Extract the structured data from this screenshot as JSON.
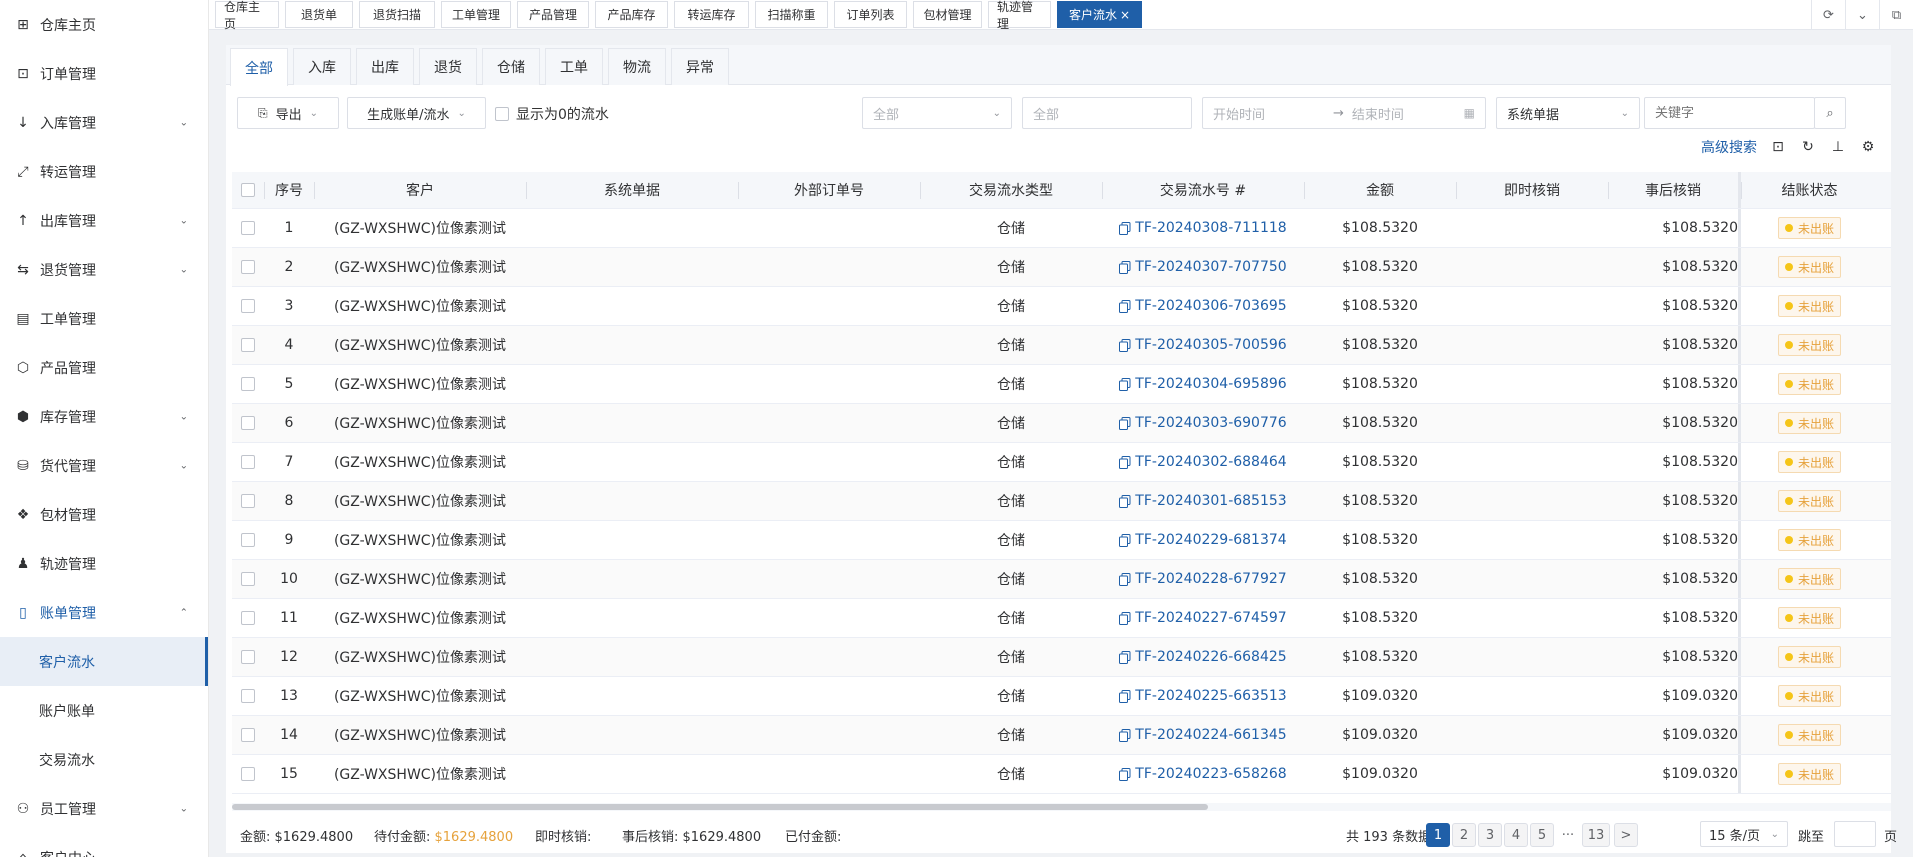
{
  "sidebar": {
    "items": [
      {
        "label": "仓库主页",
        "icon": "grid-icon",
        "chev": ""
      },
      {
        "label": "订单管理",
        "icon": "order-icon",
        "chev": ""
      },
      {
        "label": "入库管理",
        "icon": "arrow-down-icon",
        "chev": "⌄"
      },
      {
        "label": "转运管理",
        "icon": "transfer-icon",
        "chev": ""
      },
      {
        "label": "出库管理",
        "icon": "arrow-up-icon",
        "chev": "⌄"
      },
      {
        "label": "退货管理",
        "icon": "return-icon",
        "chev": "⌄"
      },
      {
        "label": "工单管理",
        "icon": "ticket-icon",
        "chev": ""
      },
      {
        "label": "产品管理",
        "icon": "product-icon",
        "chev": ""
      },
      {
        "label": "库存管理",
        "icon": "box-icon",
        "chev": "⌄"
      },
      {
        "label": "货代管理",
        "icon": "network-icon",
        "chev": "⌄"
      },
      {
        "label": "包材管理",
        "icon": "dropbox-icon",
        "chev": ""
      },
      {
        "label": "轨迹管理",
        "icon": "bell-icon",
        "chev": ""
      },
      {
        "label": "账单管理",
        "icon": "bill-icon",
        "chev": "⌃"
      }
    ],
    "sub_items": [
      "客户流水",
      "账户账单",
      "交易流水"
    ],
    "after_items": [
      {
        "label": "员工管理",
        "icon": "user-icon",
        "chev": "⌄"
      },
      {
        "label": "客户中心",
        "icon": "customer-icon",
        "chev": ""
      }
    ]
  },
  "top_tabs": [
    "仓库主页",
    "退货单",
    "退货扫描",
    "工单管理",
    "产品管理",
    "产品库存",
    "转运库存",
    "扫描称重",
    "订单列表",
    "包材管理",
    "轨迹管理",
    "客户流水"
  ],
  "top_tab_close": "×",
  "sub_tabs": [
    "全部",
    "入库",
    "出库",
    "退货",
    "仓储",
    "工单",
    "物流",
    "异常"
  ],
  "toolbar": {
    "export": "导出",
    "generate": "生成账单/流水",
    "show_zero": "显示为0的流水",
    "filter_all_select": "全部",
    "filter_all_input": "全部",
    "start_time": "开始时间",
    "arrow": "→",
    "end_time": "结束时间",
    "doc_type": "系统单据",
    "keyword_placeholder": "关键字",
    "advanced_search": "高级搜索"
  },
  "table": {
    "headers": [
      "序号",
      "客户",
      "系统单据",
      "外部订单号",
      "交易流水类型",
      "交易流水号 #",
      "金额",
      "即时核销",
      "事后核销",
      "结账状态"
    ],
    "rows": [
      {
        "seq": "1",
        "customer": "(GZ-WXSHWC)位像素测试",
        "sys": "",
        "ext": "",
        "type": "仓储",
        "no": "TF-20240308-711118",
        "amount": "$108.5320",
        "imm": "",
        "post": "$108.5320",
        "status": "未出账"
      },
      {
        "seq": "2",
        "customer": "(GZ-WXSHWC)位像素测试",
        "sys": "",
        "ext": "",
        "type": "仓储",
        "no": "TF-20240307-707750",
        "amount": "$108.5320",
        "imm": "",
        "post": "$108.5320",
        "status": "未出账"
      },
      {
        "seq": "3",
        "customer": "(GZ-WXSHWC)位像素测试",
        "sys": "",
        "ext": "",
        "type": "仓储",
        "no": "TF-20240306-703695",
        "amount": "$108.5320",
        "imm": "",
        "post": "$108.5320",
        "status": "未出账"
      },
      {
        "seq": "4",
        "customer": "(GZ-WXSHWC)位像素测试",
        "sys": "",
        "ext": "",
        "type": "仓储",
        "no": "TF-20240305-700596",
        "amount": "$108.5320",
        "imm": "",
        "post": "$108.5320",
        "status": "未出账"
      },
      {
        "seq": "5",
        "customer": "(GZ-WXSHWC)位像素测试",
        "sys": "",
        "ext": "",
        "type": "仓储",
        "no": "TF-20240304-695896",
        "amount": "$108.5320",
        "imm": "",
        "post": "$108.5320",
        "status": "未出账"
      },
      {
        "seq": "6",
        "customer": "(GZ-WXSHWC)位像素测试",
        "sys": "",
        "ext": "",
        "type": "仓储",
        "no": "TF-20240303-690776",
        "amount": "$108.5320",
        "imm": "",
        "post": "$108.5320",
        "status": "未出账"
      },
      {
        "seq": "7",
        "customer": "(GZ-WXSHWC)位像素测试",
        "sys": "",
        "ext": "",
        "type": "仓储",
        "no": "TF-20240302-688464",
        "amount": "$108.5320",
        "imm": "",
        "post": "$108.5320",
        "status": "未出账"
      },
      {
        "seq": "8",
        "customer": "(GZ-WXSHWC)位像素测试",
        "sys": "",
        "ext": "",
        "type": "仓储",
        "no": "TF-20240301-685153",
        "amount": "$108.5320",
        "imm": "",
        "post": "$108.5320",
        "status": "未出账"
      },
      {
        "seq": "9",
        "customer": "(GZ-WXSHWC)位像素测试",
        "sys": "",
        "ext": "",
        "type": "仓储",
        "no": "TF-20240229-681374",
        "amount": "$108.5320",
        "imm": "",
        "post": "$108.5320",
        "status": "未出账"
      },
      {
        "seq": "10",
        "customer": "(GZ-WXSHWC)位像素测试",
        "sys": "",
        "ext": "",
        "type": "仓储",
        "no": "TF-20240228-677927",
        "amount": "$108.5320",
        "imm": "",
        "post": "$108.5320",
        "status": "未出账"
      },
      {
        "seq": "11",
        "customer": "(GZ-WXSHWC)位像素测试",
        "sys": "",
        "ext": "",
        "type": "仓储",
        "no": "TF-20240227-674597",
        "amount": "$108.5320",
        "imm": "",
        "post": "$108.5320",
        "status": "未出账"
      },
      {
        "seq": "12",
        "customer": "(GZ-WXSHWC)位像素测试",
        "sys": "",
        "ext": "",
        "type": "仓储",
        "no": "TF-20240226-668425",
        "amount": "$108.5320",
        "imm": "",
        "post": "$108.5320",
        "status": "未出账"
      },
      {
        "seq": "13",
        "customer": "(GZ-WXSHWC)位像素测试",
        "sys": "",
        "ext": "",
        "type": "仓储",
        "no": "TF-20240225-663513",
        "amount": "$109.0320",
        "imm": "",
        "post": "$109.0320",
        "status": "未出账"
      },
      {
        "seq": "14",
        "customer": "(GZ-WXSHWC)位像素测试",
        "sys": "",
        "ext": "",
        "type": "仓储",
        "no": "TF-20240224-661345",
        "amount": "$109.0320",
        "imm": "",
        "post": "$109.0320",
        "status": "未出账"
      },
      {
        "seq": "15",
        "customer": "(GZ-WXSHWC)位像素测试",
        "sys": "",
        "ext": "",
        "type": "仓储",
        "no": "TF-20240223-658268",
        "amount": "$109.0320",
        "imm": "",
        "post": "$109.0320",
        "status": "未出账"
      }
    ]
  },
  "footer": {
    "amount_label": "金额: $1629.4800",
    "pending_label": "待付金额: ",
    "pending_value": "$1629.4800",
    "immediate_label": "即时核销:",
    "post_label": "事后核销: $1629.4800",
    "paid_label": "已付金额:",
    "total": "共 193 条数据",
    "pages": [
      "1",
      "2",
      "3",
      "4",
      "5"
    ],
    "ellipsis": "···",
    "last_page": "13",
    "next": ">",
    "page_size": "15 条/页",
    "goto": "跳至",
    "page_unit": "页"
  },
  "colors": {
    "accent": "#1f5fa8",
    "warning": "#e6a23c",
    "badge_dot": "#f5c518"
  }
}
